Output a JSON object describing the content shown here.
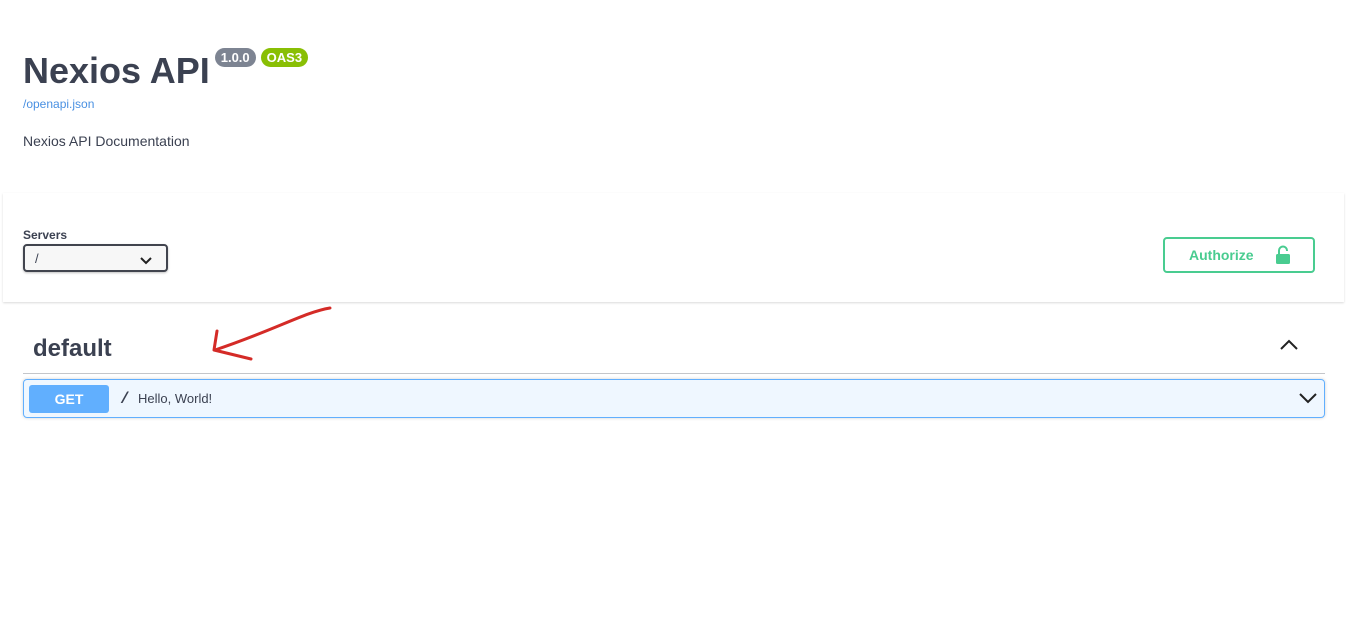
{
  "info": {
    "title": "Nexios API",
    "version": "1.0.0",
    "oas_badge": "OAS3",
    "spec_url": "/openapi.json",
    "description": "Nexios API Documentation"
  },
  "servers": {
    "label": "Servers",
    "selected": "/"
  },
  "authorize": {
    "label": "Authorize"
  },
  "tag": {
    "name": "default",
    "expanded": true
  },
  "operations": [
    {
      "method": "GET",
      "path": "/",
      "summary": "Hello, World!"
    }
  ],
  "colors": {
    "get": "#61affe",
    "authorize": "#49cc90",
    "oas_badge": "#89bf04",
    "version_badge": "#7d8492",
    "annotation": "#d42b27"
  }
}
